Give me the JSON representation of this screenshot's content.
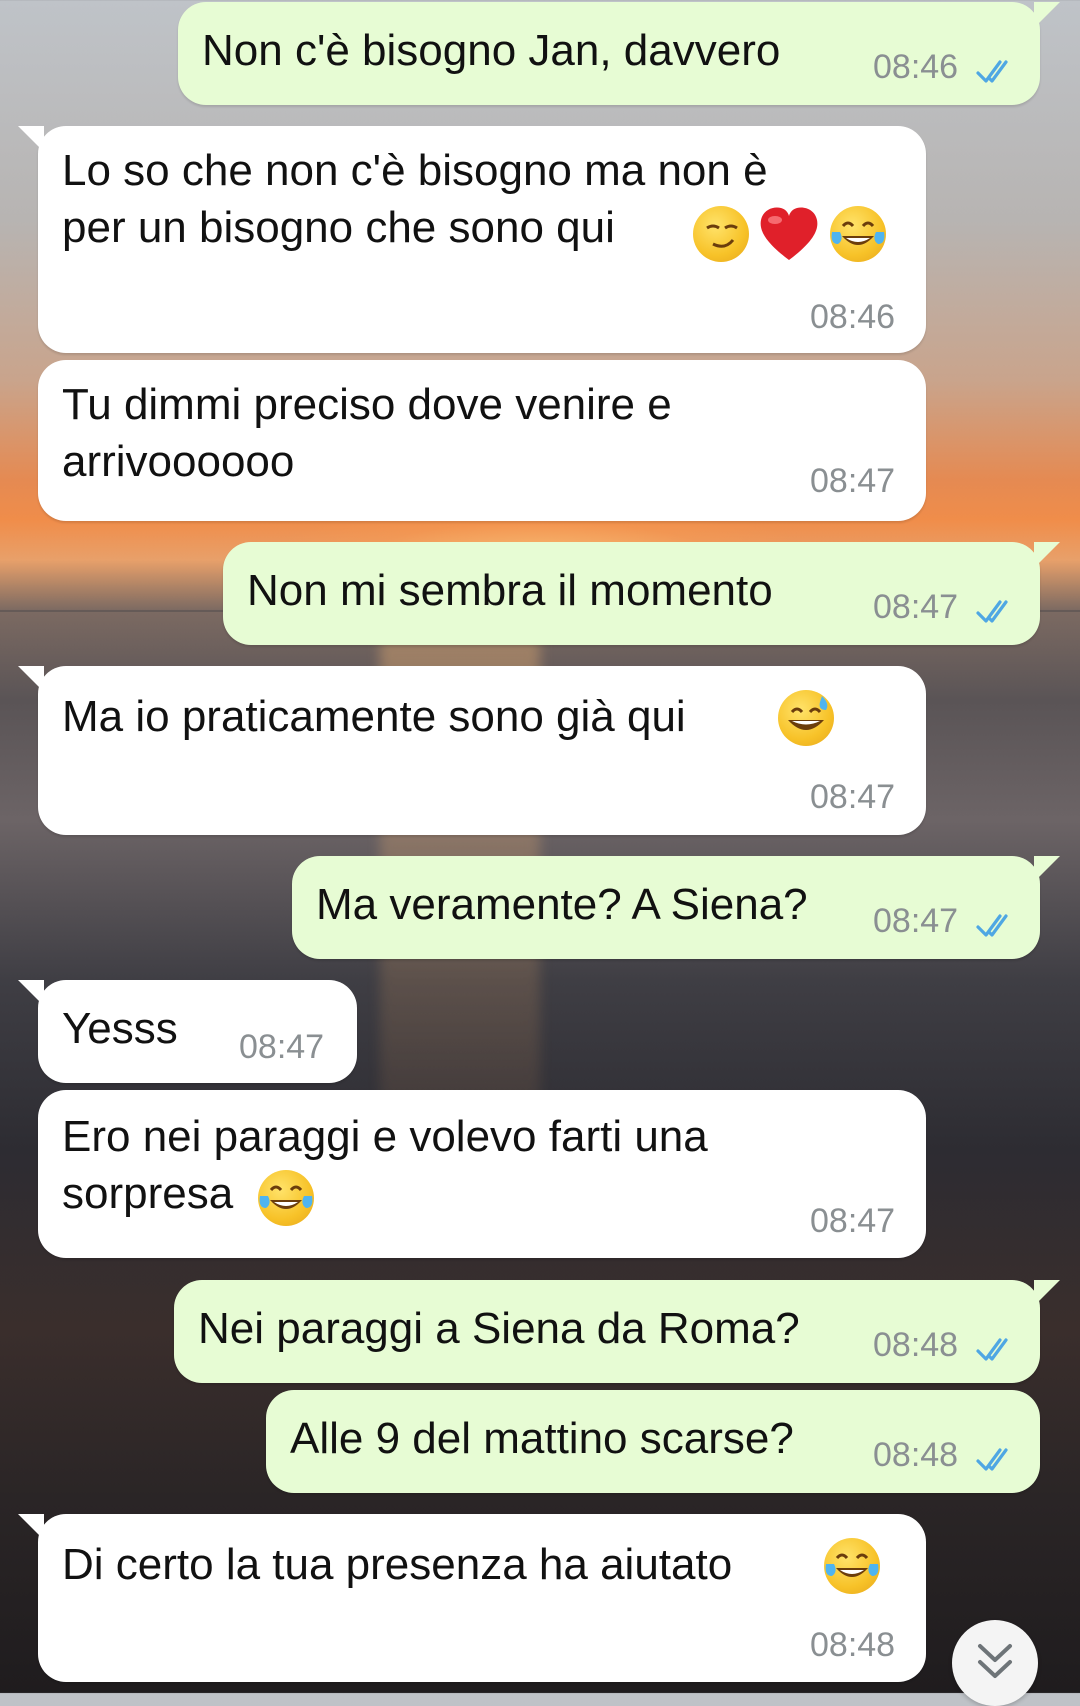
{
  "messages": [
    {
      "dir": "out",
      "text": "Non c'è bisogno Jan, davvero",
      "time": "08:46",
      "read": true
    },
    {
      "dir": "in",
      "text": "Lo so che non c'è bisogno ma non è\nper un bisogno che sono qui",
      "emojis": [
        "smirk-emoji",
        "red-heart-emoji",
        "tears-of-joy-emoji"
      ],
      "time": "08:46"
    },
    {
      "dir": "in",
      "text": "Tu dimmi preciso dove venire e\narrivoooooo",
      "time": "08:47"
    },
    {
      "dir": "out",
      "text": "Non mi sembra il momento",
      "time": "08:47",
      "read": true
    },
    {
      "dir": "in",
      "text": "Ma io praticamente sono già qui",
      "emojis": [
        "grinning-sweat-emoji"
      ],
      "time": "08:47"
    },
    {
      "dir": "out",
      "text": "Ma veramente? A Siena?",
      "time": "08:47",
      "read": true
    },
    {
      "dir": "in",
      "text": "Yesss",
      "time": "08:47"
    },
    {
      "dir": "in",
      "text": "Ero nei paraggi e volevo farti una\nsorpresa",
      "emojis": [
        "tears-of-joy-emoji"
      ],
      "time": "08:47"
    },
    {
      "dir": "out",
      "text": "Nei paraggi a Siena da Roma?",
      "time": "08:48",
      "read": true
    },
    {
      "dir": "out",
      "text": "Alle 9 del mattino scarse?",
      "time": "08:48",
      "read": true
    },
    {
      "dir": "in",
      "text": "Di certo la tua presenza ha aiutato",
      "emojis": [
        "tears-of-joy-emoji"
      ],
      "time": "08:48"
    }
  ],
  "colors": {
    "incoming": "#ffffff",
    "outgoing": "#e7fcd4",
    "read_ticks": "#4fa7e3",
    "time": "#8a8f92"
  },
  "scroll_button_icon": "double-chevron-down-icon"
}
